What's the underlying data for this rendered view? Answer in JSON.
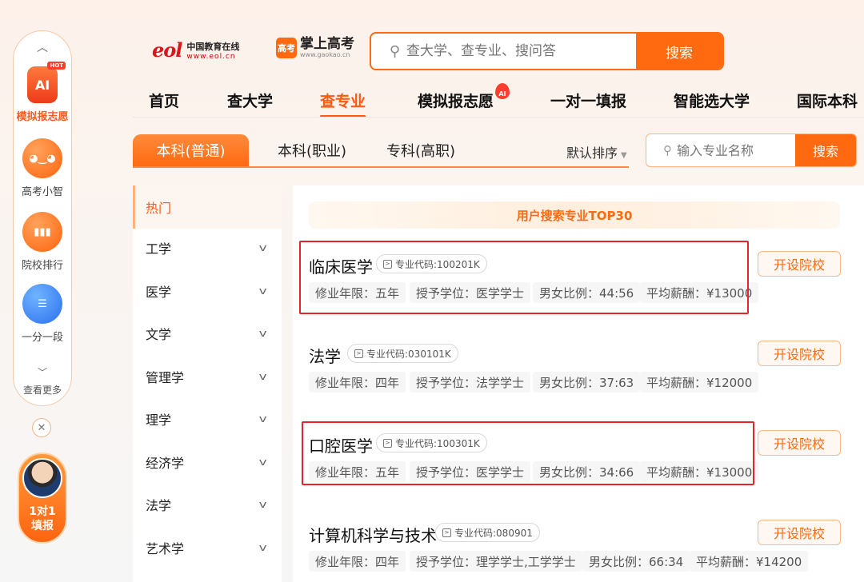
{
  "sidebar": {
    "ai_badge": "HOT",
    "ai_icon_text": "AI",
    "items": [
      {
        "label": "模拟报志愿"
      },
      {
        "label": "高考小智"
      },
      {
        "label": "院校排行"
      },
      {
        "label": "一分一段"
      }
    ],
    "more": "查看更多",
    "consult": "1对1填报"
  },
  "header": {
    "eol_mark": "eol",
    "eol_name": "中国教育在线",
    "eol_url": "www.eol.cn",
    "gk_mark": "高考",
    "gk_name": "掌上高考",
    "gk_url": "www.gaokao.cn",
    "search_placeholder": "查大学、查专业、搜问答",
    "search_button": "搜索"
  },
  "nav": {
    "items": [
      "首页",
      "查大学",
      "查专业",
      "模拟报志愿",
      "一对一填报",
      "智能选大学",
      "国际本科"
    ],
    "ai_badge": "AI"
  },
  "tabs": [
    "本科(普通)",
    "本科(职业)",
    "专科(高职)"
  ],
  "sort_label": "默认排序",
  "major_search": {
    "placeholder": "输入专业名称",
    "button": "搜索"
  },
  "categories": [
    "热门",
    "工学",
    "医学",
    "文学",
    "管理学",
    "理学",
    "经济学",
    "法学",
    "艺术学"
  ],
  "top30_title": "用户搜索专业TOP30",
  "majors": [
    {
      "name": "临床医学",
      "code": "专业代码:100201K",
      "years": "修业年限：五年",
      "degree": "授予学位：医学学士",
      "ratio": "男女比例：44:56",
      "salary": "平均薪酬：¥13000",
      "button": "开设院校"
    },
    {
      "name": "法学",
      "code": "专业代码:030101K",
      "years": "修业年限：四年",
      "degree": "授予学位：法学学士",
      "ratio": "男女比例：37:63",
      "salary": "平均薪酬：¥12000",
      "button": "开设院校"
    },
    {
      "name": "口腔医学",
      "code": "专业代码:100301K",
      "years": "修业年限：五年",
      "degree": "授予学位：医学学士",
      "ratio": "男女比例：34:66",
      "salary": "平均薪酬：¥13000",
      "button": "开设院校"
    },
    {
      "name": "计算机科学与技术",
      "code": "专业代码:080901",
      "years": "修业年限：四年",
      "degree": "授予学位：理学学士,工学学士",
      "ratio": "男女比例：66:34",
      "salary": "平均薪酬：¥14200",
      "button": "开设院校"
    }
  ],
  "colors": {
    "accent": "#ff6a10",
    "highlight_box": "#e5242b"
  }
}
